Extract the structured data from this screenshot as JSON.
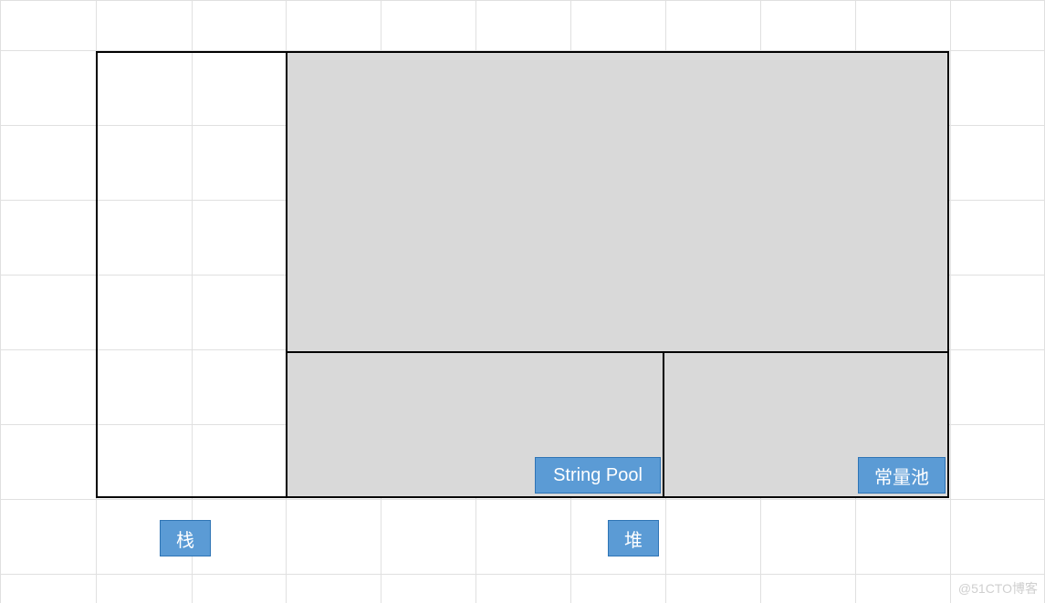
{
  "diagram": {
    "labels": {
      "stack": "栈",
      "heap": "堆",
      "string_pool": "String Pool",
      "constant_pool": "常量池"
    },
    "regions": {
      "stack": {
        "role": "栈 (Stack)"
      },
      "heap": {
        "role": "堆 (Heap)"
      },
      "string_pool": {
        "role": "String Pool (inside Heap)"
      },
      "constant_pool": {
        "role": "常量池 (Constant Pool, inside Heap)"
      }
    }
  },
  "watermark": "@51CTO博客",
  "chart_data": {
    "type": "diagram",
    "title": "",
    "description": "JVM memory layout diagram showing Stack and Heap; Heap contains String Pool and Constant Pool sub-regions.",
    "nodes": [
      {
        "id": "stack",
        "label": "栈",
        "parent": null
      },
      {
        "id": "heap",
        "label": "堆",
        "parent": null
      },
      {
        "id": "string_pool",
        "label": "String Pool",
        "parent": "heap"
      },
      {
        "id": "constant_pool",
        "label": "常量池",
        "parent": "heap"
      }
    ]
  }
}
